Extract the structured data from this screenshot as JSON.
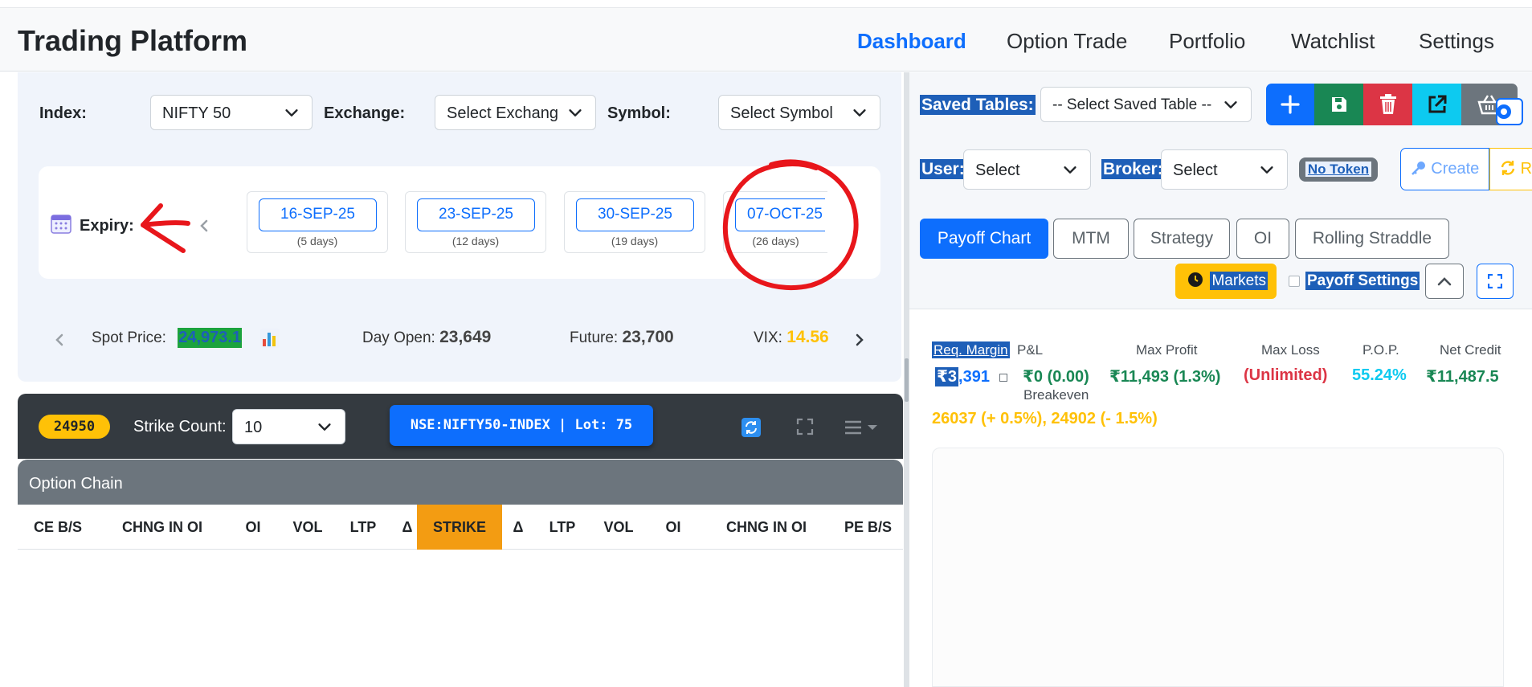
{
  "navbar": {
    "brand": "Trading Platform",
    "links": [
      "Dashboard",
      "Option Trade",
      "Portfolio",
      "Watchlist",
      "Settings"
    ]
  },
  "filters": {
    "index_label": "Index:",
    "index_value": "NIFTY 50",
    "exchange_label": "Exchange:",
    "exchange_value": "Select Exchang",
    "symbol_label": "Symbol:",
    "symbol_value": "Select Symbol"
  },
  "expiry": {
    "label": "Expiry:",
    "items": [
      {
        "date": "16-SEP-25",
        "days": "(5 days)"
      },
      {
        "date": "23-SEP-25",
        "days": "(12 days)"
      },
      {
        "date": "30-SEP-25",
        "days": "(19 days)"
      },
      {
        "date": "07-OCT-25",
        "days": "(26 days)"
      }
    ]
  },
  "market": {
    "spot_label": "Spot Price:",
    "spot_value": "24,973.1",
    "day_open_label": "Day Open:",
    "day_open_value": "23,649",
    "future_label": "Future:",
    "future_value": "23,700",
    "vix_label": "VIX:",
    "vix_value": "14.56"
  },
  "chain_toolbar": {
    "atm_strike": "24950",
    "strike_count_label": "Strike Count:",
    "strike_count_value": "10",
    "instrument": "NSE:NIFTY50-INDEX | Lot: 75"
  },
  "option_chain": {
    "title": "Option Chain",
    "columns": [
      "CE B/S",
      "CHNG IN OI",
      "OI",
      "VOL",
      "LTP",
      "Δ",
      "STRIKE",
      "Δ",
      "LTP",
      "VOL",
      "OI",
      "CHNG IN OI",
      "PE B/S"
    ]
  },
  "right": {
    "saved_tables_label": "Saved Tables:",
    "saved_tables_value": "-- Select Saved Table --",
    "user_label": "User:",
    "user_value": "Select",
    "broker_label": "Broker:",
    "broker_value": "Select",
    "token_badge": "No Token",
    "create_label": "Create",
    "refresh_label": "R",
    "tabs": [
      "Payoff Chart",
      "MTM",
      "Strategy",
      "OI",
      "Rolling Straddle"
    ],
    "markets_label": "Markets",
    "payoff_settings_label": "Payoff Settings"
  },
  "stats": {
    "req_margin_label": "Req. Margin",
    "req_margin_prefix": "₹3",
    "req_margin_rest": ",391",
    "pl_label": "P&L",
    "pl_value": "₹0 (0.00)",
    "max_profit_label": "Max Profit",
    "max_profit_value": "₹11,493 (1.3%)",
    "max_loss_label": "Max Loss",
    "max_loss_value": "(Unlimited)",
    "pop_label": "P.O.P.",
    "pop_value": "55.24%",
    "net_credit_label": "Net Credit",
    "net_credit_value": "₹11,487.5",
    "breakeven_label": "Breakeven",
    "breakeven_value": "26037 (+ 0.5%), 24902 (- 1.5%)"
  },
  "colors": {
    "primary": "#0d6efd",
    "success": "#198754",
    "danger": "#dc3545",
    "warning": "#ffc107",
    "info": "#0dcaf0",
    "secondary": "#6c757d",
    "annotation_red": "#e8161b"
  }
}
